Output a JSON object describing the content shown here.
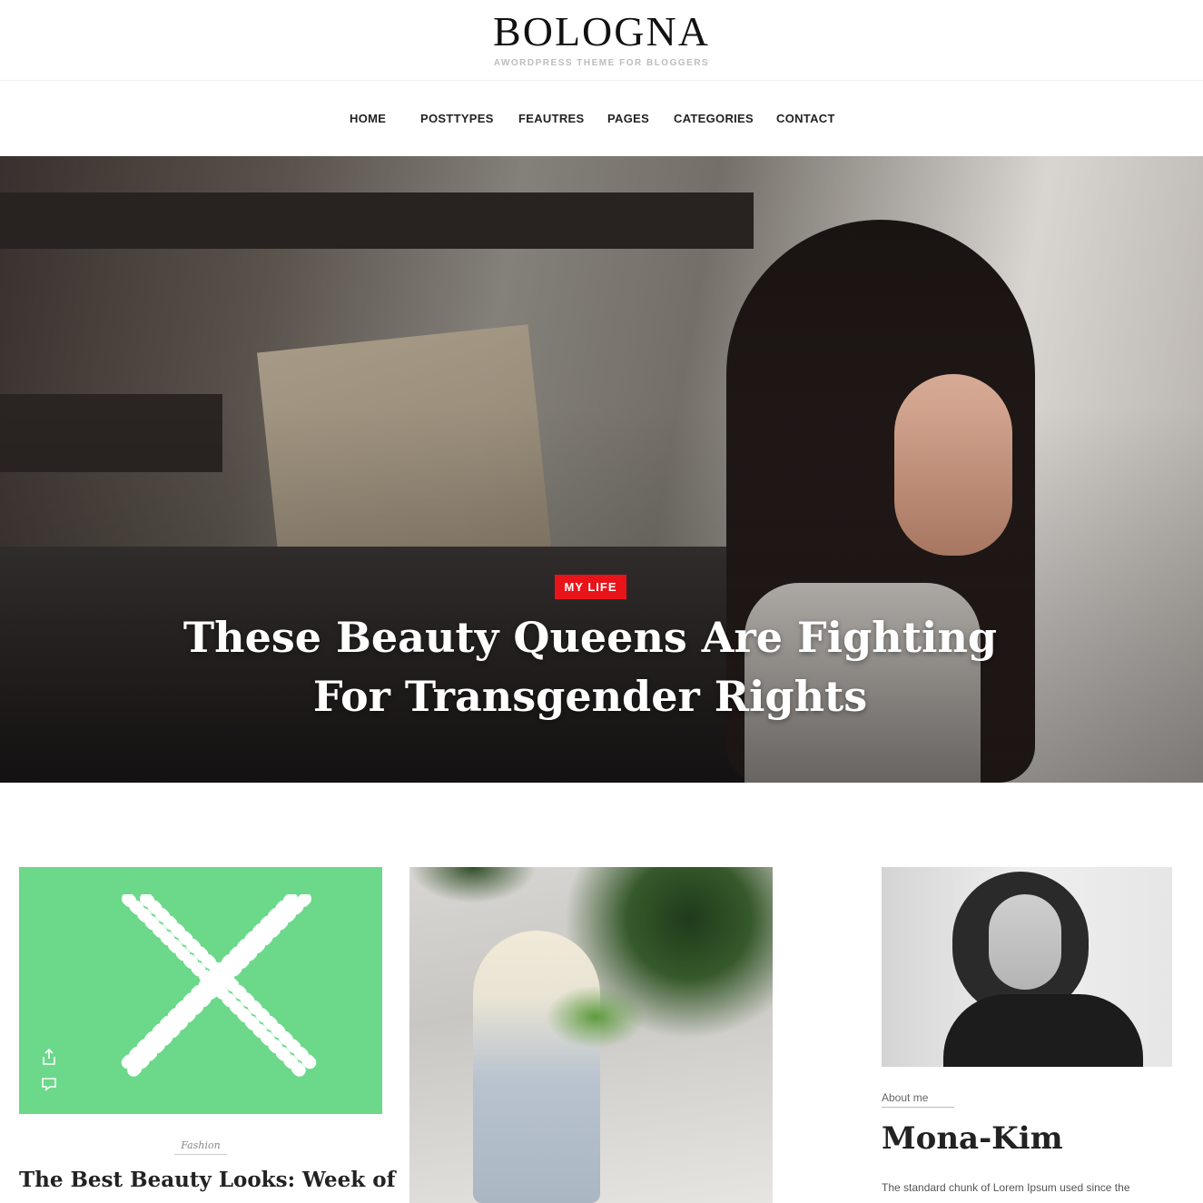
{
  "site": {
    "logo": "BOLOGNA",
    "tagline": "AWORDPRESS THEME FOR BLOGGERS"
  },
  "nav": {
    "items": [
      {
        "label": "HOME"
      },
      {
        "label": "POSTTYPES"
      },
      {
        "label": "FEAUTRES"
      },
      {
        "label": "PAGES"
      },
      {
        "label": "CATEGORIES"
      },
      {
        "label": "CONTACT"
      }
    ]
  },
  "hero": {
    "category": "MY LIFE",
    "title": "These Beauty Queens Are Fighting For Transgender Rights"
  },
  "posts": [
    {
      "category": "Fashion",
      "title": "The Best Beauty Looks: Week of"
    }
  ],
  "about": {
    "label": "About  me",
    "name": "Mona-Kim",
    "text": "The standard chunk of Lorem Ipsum used since the"
  },
  "colors": {
    "accent": "#e8141a",
    "card_green": "#6cd88a"
  },
  "icons": [
    "share-icon",
    "comment-icon"
  ]
}
